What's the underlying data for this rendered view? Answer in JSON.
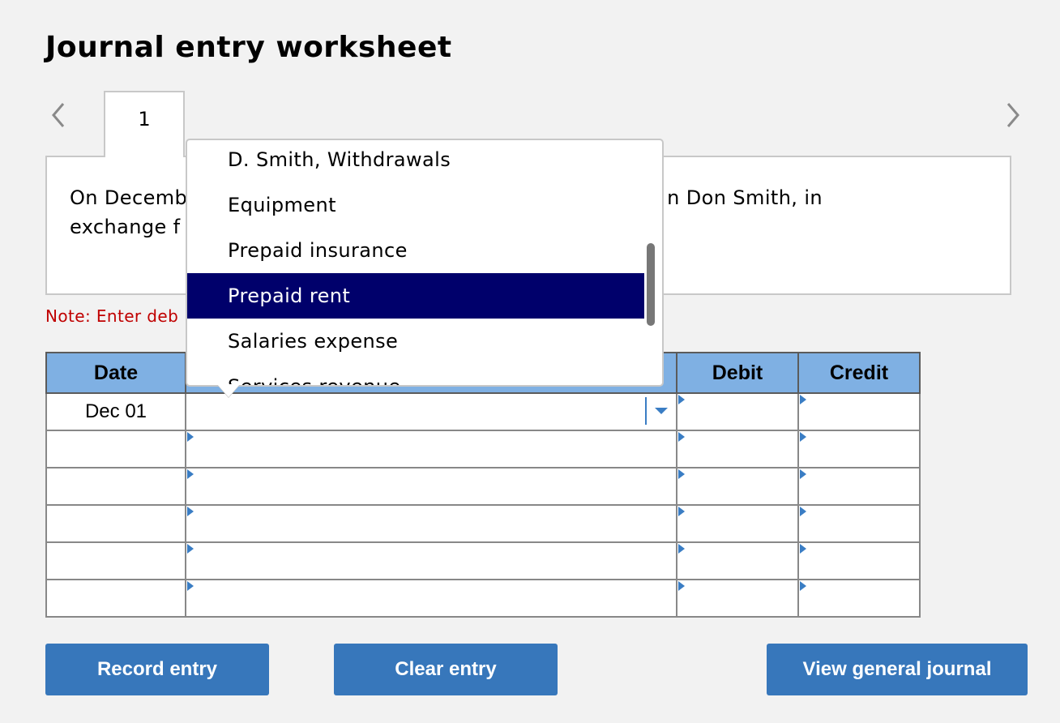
{
  "page": {
    "title": "Journal entry worksheet"
  },
  "tabs": [
    {
      "label": "1"
    }
  ],
  "prompt": {
    "line1_left": "On Decemb",
    "line1_right": "n Don Smith, in",
    "line2_left": "exchange f"
  },
  "note": "Note: Enter deb",
  "table": {
    "headers": {
      "date": "Date",
      "account": "",
      "debit": "Debit",
      "credit": "Credit"
    },
    "rows": [
      {
        "date": "Dec 01",
        "account": "",
        "debit": "",
        "credit": ""
      },
      {
        "date": "",
        "account": "",
        "debit": "",
        "credit": ""
      },
      {
        "date": "",
        "account": "",
        "debit": "",
        "credit": ""
      },
      {
        "date": "",
        "account": "",
        "debit": "",
        "credit": ""
      },
      {
        "date": "",
        "account": "",
        "debit": "",
        "credit": ""
      },
      {
        "date": "",
        "account": "",
        "debit": "",
        "credit": ""
      }
    ]
  },
  "dropdown": {
    "items": [
      "D. Smith, Withdrawals",
      "Equipment",
      "Prepaid insurance",
      "Prepaid rent",
      "Salaries expense",
      "Services revenue"
    ],
    "selected": "Prepaid rent"
  },
  "buttons": {
    "record": "Record entry",
    "clear": "Clear entry",
    "view": "View general journal"
  },
  "colors": {
    "header_bg": "#7fb0e3",
    "button_bg": "#3777bb",
    "selected_bg": "#00006b",
    "note_text": "#c00000",
    "input_border": "#3a7dc4"
  },
  "icons": {
    "prev": "chevron-left-icon",
    "next": "chevron-right-icon",
    "select": "caret-down-icon"
  }
}
